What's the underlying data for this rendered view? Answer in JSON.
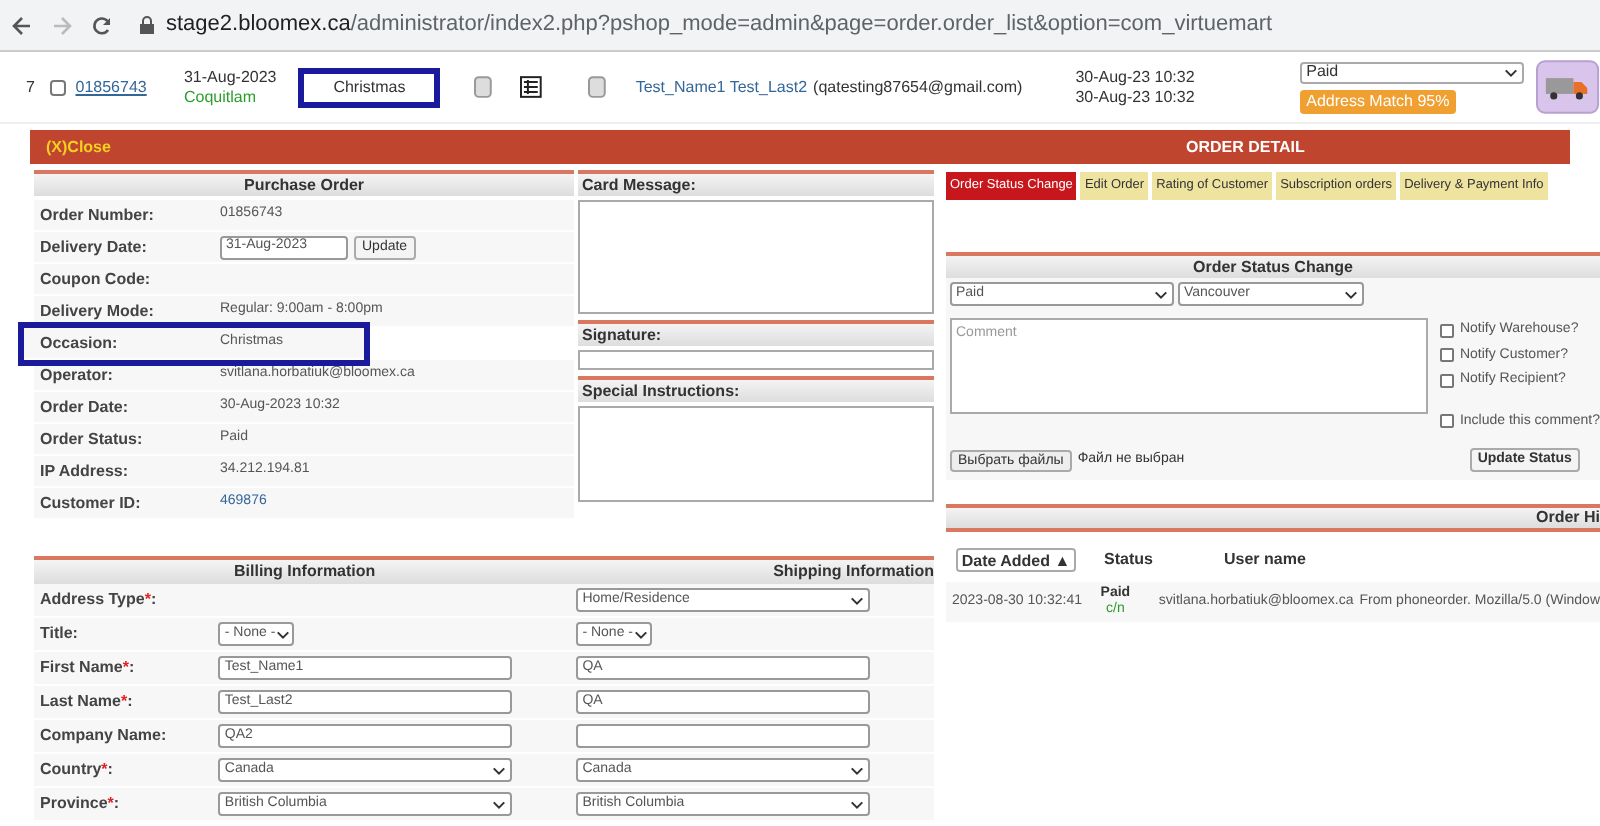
{
  "browser": {
    "url_host": "stage2.bloomex.ca",
    "url_path": "/administrator/index2.php?pshop_mode=admin&page=order.order_list&option=com_virtuemart"
  },
  "order_row": {
    "index": "7",
    "checked": false,
    "order_number": "01856743",
    "delivery_date": "31-Aug-2023",
    "city": "Coquitlam",
    "occasion": "Christmas",
    "occasion_highlighted": true,
    "customer": "Test_Name1 Test_Last2",
    "email": "(qatesting87654@gmail.com)",
    "dates": [
      "30-Aug-23 10:32",
      "30-Aug-23 10:32"
    ],
    "status": "Paid",
    "badge": "Address Match 95%"
  },
  "detail_bar": {
    "close": "(X)Close",
    "title": "ORDER DETAIL"
  },
  "purchase_order": {
    "title": "Purchase Order",
    "rows": [
      {
        "kind": "text",
        "label": "Order Number:",
        "value": "01856743",
        "highlighted": false
      },
      {
        "kind": "date",
        "label": "Delivery Date:",
        "value": "31-Aug-2023",
        "button": "Update",
        "highlighted": false
      },
      {
        "kind": "text",
        "label": "Coupon Code:",
        "highlighted": false
      },
      {
        "kind": "text",
        "label": "Delivery Mode:",
        "value": "Regular: 9:00am - 8:00pm",
        "highlighted": false
      },
      {
        "kind": "text",
        "label": "Occasion:",
        "value": "Christmas",
        "highlighted": true
      },
      {
        "kind": "text",
        "label": "Operator:",
        "value": "svitlana.horbatiuk@bloomex.ca",
        "highlighted": false
      },
      {
        "kind": "text",
        "label": "Order Date:",
        "value": "30-Aug-2023 10:32",
        "highlighted": false
      },
      {
        "kind": "text",
        "label": "Order Status:",
        "value": "Paid",
        "highlighted": false
      },
      {
        "kind": "text",
        "label": "IP Address:",
        "value": "34.212.194.81",
        "highlighted": false
      },
      {
        "kind": "link",
        "label": "Customer ID:",
        "value": "469876",
        "highlighted": false
      }
    ]
  },
  "card_message": {
    "title": "Card Message:"
  },
  "signature": {
    "title": "Signature:"
  },
  "special_instructions": {
    "title": "Special Instructions:"
  },
  "addresses": {
    "billing_title": "Billing Information",
    "shipping_title": "Shipping Information",
    "rows": [
      {
        "label": "Address Type",
        "required_mark": "*",
        "label_end": ":",
        "shipping": {
          "kind": "select",
          "value": "Home/Residence"
        }
      },
      {
        "label": "Title:",
        "billing": {
          "kind": "short_select",
          "value": "- None -"
        },
        "shipping": {
          "kind": "short_select",
          "value": "- None -"
        }
      },
      {
        "label": "First Name",
        "required_mark": "*",
        "label_end": ":",
        "billing": {
          "kind": "input",
          "value": "Test_Name1"
        },
        "shipping": {
          "kind": "input",
          "value": "QA"
        }
      },
      {
        "label": "Last Name",
        "required_mark": "*",
        "label_end": ":",
        "billing": {
          "kind": "input",
          "value": "Test_Last2"
        },
        "shipping": {
          "kind": "input",
          "value": "QA"
        }
      },
      {
        "label": "Company Name:",
        "billing": {
          "kind": "input",
          "value": "QA2"
        },
        "shipping": {
          "kind": "input"
        }
      },
      {
        "label": "Country",
        "required_mark": "*",
        "label_end": ":",
        "billing": {
          "kind": "select",
          "value": "Canada"
        },
        "shipping": {
          "kind": "select",
          "value": "Canada"
        }
      },
      {
        "label": "Province",
        "required_mark": "*",
        "label_end": ":",
        "billing": {
          "kind": "select",
          "value": "British Columbia"
        },
        "shipping": {
          "kind": "select",
          "value": "British Columbia"
        }
      }
    ]
  },
  "tabs": [
    {
      "label": "Order Status Change",
      "selected": true
    },
    {
      "label": "Edit Order",
      "selected": false
    },
    {
      "label": "Rating of Customer",
      "selected": false
    },
    {
      "label": "Subscription orders",
      "selected": false
    },
    {
      "label": "Delivery & Payment Info",
      "selected": false
    }
  ],
  "status_change": {
    "title": "Order Status Change",
    "status": "Paid",
    "warehouse": "Vancouver",
    "comment_placeholder": "Comment",
    "options": [
      {
        "label": "Notify Warehouse?",
        "checked": false
      },
      {
        "label": "Notify Customer?",
        "checked": false
      },
      {
        "label": "Notify Recipient?",
        "checked": false
      },
      {
        "label": "Include this comment?",
        "checked": false
      }
    ],
    "file_button": "Выбрать файлы",
    "file_status": "Файл не выбран",
    "submit": "Update Status"
  },
  "history": {
    "title": "Order Hi",
    "columns": [
      "Date Added ▲",
      "Status",
      "User name"
    ],
    "rows": [
      {
        "date": "2023-08-30 10:32:41",
        "status": "Paid",
        "status_note": "c/n",
        "user": "svitlana.horbatiuk@bloomex.ca",
        "note": "From phoneorder. Mozilla/5.0 (Window"
      }
    ]
  }
}
